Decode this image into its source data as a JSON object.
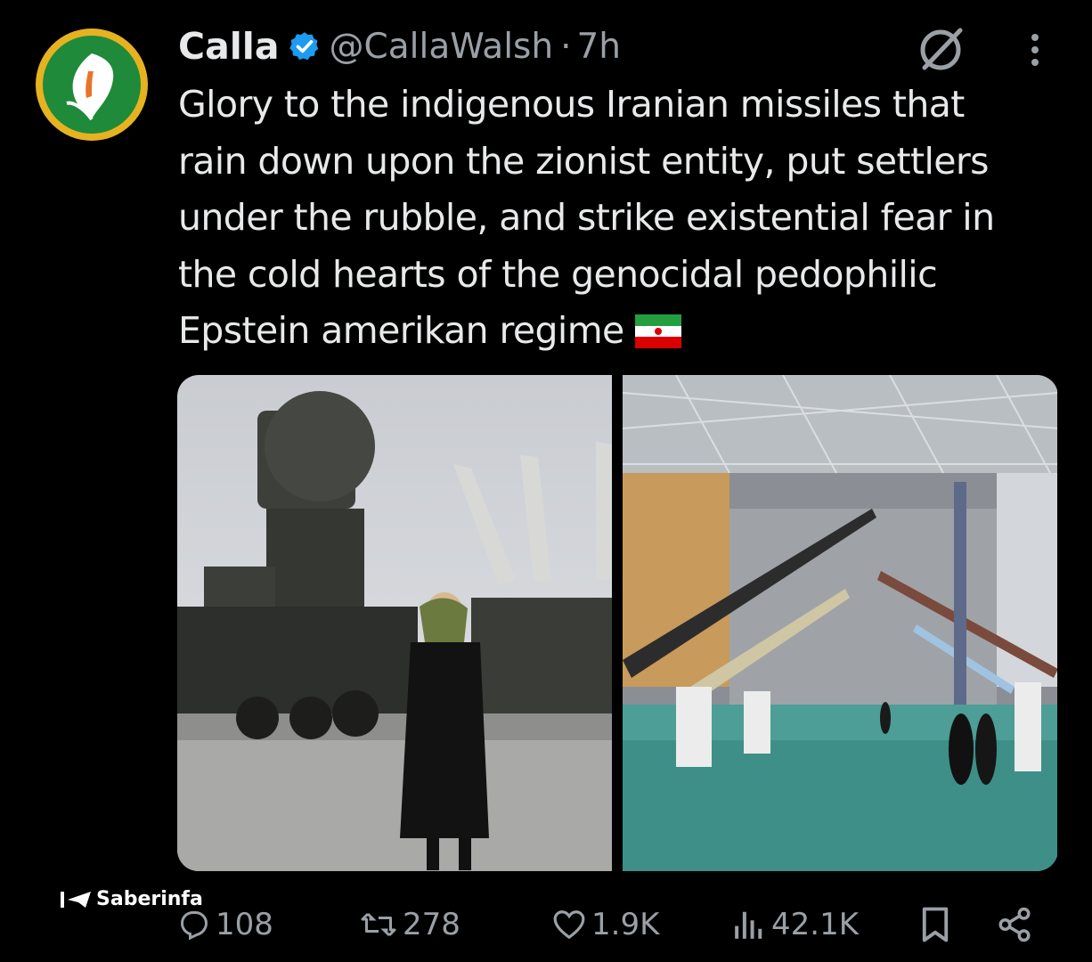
{
  "tweet": {
    "display_name": "Calla",
    "handle": "@CallaWalsh",
    "separator": "·",
    "time": "7h",
    "text_lines": [
      "Glory to the indigenous Iranian missiles that",
      "rain down upon the zionist entity, put settlers",
      "under the rubble, and strike existential fear in",
      "the cold hearts of the genocidal pedophilic",
      "Epstein amerikan regime"
    ],
    "emoji": "iran-flag"
  },
  "actions": {
    "replies": "108",
    "reposts": "278",
    "likes": "1.9K",
    "views": "42.1K"
  },
  "watermark": {
    "text": "Saberinfa"
  },
  "colors": {
    "background": "#000000",
    "text": "#e7e9ea",
    "muted": "#9aa0a6",
    "verified": "#1d9bf0",
    "avatar_ring": "#e6b220",
    "avatar_fill": "#1f8a3a"
  },
  "icons": {
    "verified": "verified-badge-icon",
    "grok": "grok-icon",
    "more": "more-icon",
    "reply": "reply-icon",
    "repost": "repost-icon",
    "like": "heart-icon",
    "views": "views-icon",
    "bookmark": "bookmark-icon",
    "share": "share-icon"
  }
}
